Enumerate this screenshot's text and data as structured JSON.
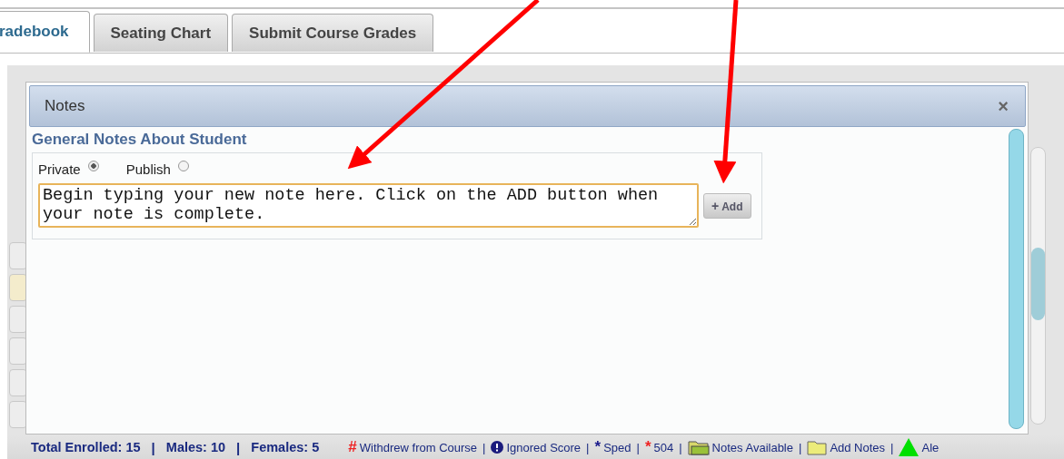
{
  "tabs": [
    {
      "label": "radebook",
      "selected": true
    },
    {
      "label": "Seating Chart",
      "selected": false
    },
    {
      "label": "Submit Course Grades",
      "selected": false
    }
  ],
  "dialog": {
    "title": "Notes",
    "close": "×",
    "section_title": "General Notes About Student",
    "visibility": [
      {
        "label": "Private",
        "selected": true
      },
      {
        "label": "Publish",
        "selected": false
      }
    ],
    "note": {
      "value": "Begin typing your new note here. Click on the ADD button when your note is complete."
    },
    "add_button": {
      "icon": "+",
      "label": "Add"
    }
  },
  "status_bar": {
    "summary": [
      {
        "text": "Total Enrolled: 15",
        "separator": "|"
      },
      {
        "text": "Males: 10",
        "separator": "|"
      },
      {
        "text": "Females: 5"
      }
    ],
    "legend": [
      {
        "kind": "glyph",
        "glyph": "#",
        "color": "#ee2222",
        "label": "Withdrew from Course",
        "separator": "|"
      },
      {
        "kind": "info",
        "label": "Ignored Score",
        "separator": "|"
      },
      {
        "kind": "glyph",
        "glyph": "*",
        "color": "#1a1a8c",
        "label": "Sped",
        "separator": "|"
      },
      {
        "kind": "glyph",
        "glyph": "*",
        "color": "#ee2222",
        "label": "504",
        "separator": "|"
      },
      {
        "kind": "notes-folder",
        "label": "Notes Available",
        "separator": "|"
      },
      {
        "kind": "folder",
        "label": "Add Notes",
        "separator": "|"
      },
      {
        "kind": "triangle",
        "label": "Ale"
      }
    ]
  }
}
